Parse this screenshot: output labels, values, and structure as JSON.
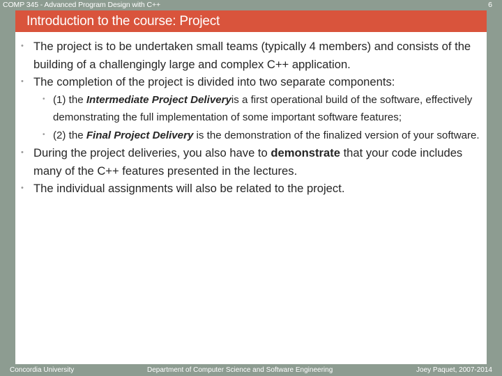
{
  "header": {
    "course_title": "COMP 345 - Advanced Program Design with C++",
    "page_number": "6"
  },
  "title_bar": {
    "title": "Introduction to the course: Project"
  },
  "colors": {
    "accent_red": "#d9543c",
    "band_gray_green": "#8d9c91",
    "body_text": "#262626",
    "bullet_dot": "#9a9a9a",
    "slide_background": "#ffffff"
  },
  "icons": {
    "bullet_dot": "bullet-dot-icon"
  },
  "bullets": [
    {
      "level": 1,
      "marker": "•",
      "runs": [
        {
          "text": "The project is to be undertaken small teams (typically 4 members) and consists of the building of a challengingly large and complex C++ application.",
          "style": "normal"
        }
      ]
    },
    {
      "level": 1,
      "marker": "•",
      "runs": [
        {
          "text": "The completion of the project is divided into two separate components:",
          "style": "normal"
        }
      ]
    },
    {
      "level": 2,
      "marker": "•",
      "runs": [
        {
          "text": "(1) the ",
          "style": "normal"
        },
        {
          "text": "Intermediate Project Delivery",
          "style": "bold-italic"
        },
        {
          "text": "is a first operational build of the software, effectively demonstrating the full implementation of some important software features;",
          "style": "normal"
        }
      ]
    },
    {
      "level": 2,
      "marker": "•",
      "runs": [
        {
          "text": "(2) the ",
          "style": "normal"
        },
        {
          "text": "Final Project Delivery",
          "style": "bold-italic"
        },
        {
          "text": " is the demonstration of the finalized version of your software.",
          "style": "normal"
        }
      ]
    },
    {
      "level": 1,
      "marker": "•",
      "runs": [
        {
          "text": "During the project deliveries, you also have to ",
          "style": "normal"
        },
        {
          "text": "demonstrate",
          "style": "bold"
        },
        {
          "text": " that your code includes many of the C++ features presented in the lectures.",
          "style": "normal"
        }
      ]
    },
    {
      "level": 1,
      "marker": "•",
      "runs": [
        {
          "text": "The individual assignments will also be related to the project.",
          "style": "normal"
        }
      ]
    }
  ],
  "footer": {
    "left": "Concordia University",
    "center": "Department of Computer Science and Software Engineering",
    "right": "Joey Paquet, 2007-2014"
  }
}
